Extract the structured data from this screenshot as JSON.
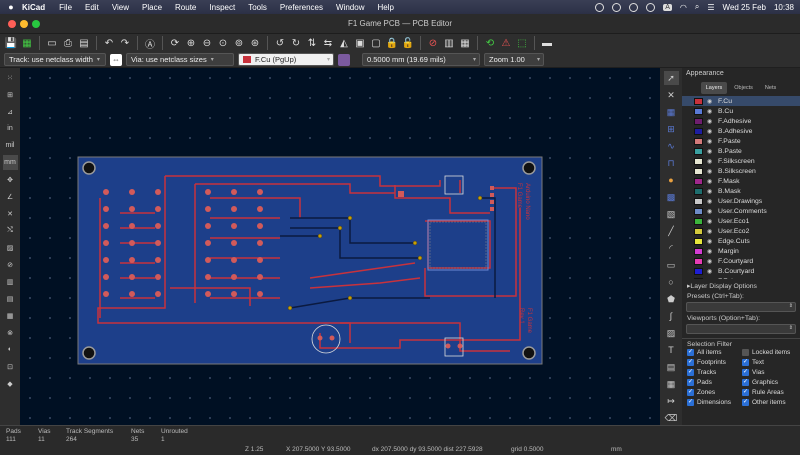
{
  "menubar": {
    "app": "KiCad",
    "items": [
      "File",
      "Edit",
      "View",
      "Place",
      "Route",
      "Inspect",
      "Tools",
      "Preferences",
      "Window",
      "Help"
    ],
    "badge": "A",
    "date": "Wed 25 Feb",
    "time": "10:38"
  },
  "window": {
    "title": "F1 Game PCB — PCB Editor"
  },
  "toolbar2": {
    "track": "Track: use netclass width",
    "via": "Via: use netclass sizes",
    "layer": "F.Cu (PgUp)",
    "grid": "0.5000 mm (19.69 mils)",
    "zoom": "Zoom 1.00"
  },
  "left_toolbar": {
    "units_in": "in",
    "units_mil": "mil",
    "units_mm": "mm"
  },
  "board": {
    "top_text": "Arduino Nano\nF1 Game",
    "bottom_text": "F1 Game\nRev 1"
  },
  "panel": {
    "title": "Appearance",
    "tabs": [
      "Layers",
      "Objects",
      "Nets"
    ],
    "layers": [
      {
        "name": "F.Cu",
        "color": "#c8323c"
      },
      {
        "name": "B.Cu",
        "color": "#5a7ad6"
      },
      {
        "name": "F.Adhesive",
        "color": "#6e1e6e"
      },
      {
        "name": "B.Adhesive",
        "color": "#1e1ea0"
      },
      {
        "name": "F.Paste",
        "color": "#d27a7a"
      },
      {
        "name": "B.Paste",
        "color": "#3aa0a0"
      },
      {
        "name": "F.Silkscreen",
        "color": "#e6e6d2"
      },
      {
        "name": "B.Silkscreen",
        "color": "#e6e6d2"
      },
      {
        "name": "F.Mask",
        "color": "#a0288c"
      },
      {
        "name": "B.Mask",
        "color": "#1e6e6e"
      },
      {
        "name": "User.Drawings",
        "color": "#c8c8c8"
      },
      {
        "name": "User.Comments",
        "color": "#6e8cc8"
      },
      {
        "name": "User.Eco1",
        "color": "#3cb43c"
      },
      {
        "name": "User.Eco2",
        "color": "#d2c83c"
      },
      {
        "name": "Edge.Cuts",
        "color": "#e6e63c"
      },
      {
        "name": "Margin",
        "color": "#d23cd2"
      },
      {
        "name": "F.Courtyard",
        "color": "#e63cb4"
      },
      {
        "name": "B.Courtyard",
        "color": "#1e1ed2"
      },
      {
        "name": "F.Fab",
        "color": "#b4b4b4"
      }
    ],
    "layer_display_options": "Layer Display Options",
    "presets_label": "Presets (Ctrl+Tab):",
    "viewports_label": "Viewports (Option+Tab):",
    "selection_filter": "Selection Filter",
    "filters": [
      {
        "label": "All items",
        "checked": true
      },
      {
        "label": "Locked items",
        "checked": false
      },
      {
        "label": "Footprints",
        "checked": true
      },
      {
        "label": "Text",
        "checked": true
      },
      {
        "label": "Tracks",
        "checked": true
      },
      {
        "label": "Vias",
        "checked": true
      },
      {
        "label": "Pads",
        "checked": true
      },
      {
        "label": "Graphics",
        "checked": true
      },
      {
        "label": "Zones",
        "checked": true
      },
      {
        "label": "Rule Areas",
        "checked": true
      },
      {
        "label": "Dimensions",
        "checked": true
      },
      {
        "label": "Other items",
        "checked": true
      }
    ]
  },
  "statusbar": {
    "pads_label": "Pads",
    "pads": "111",
    "vias_label": "Vias",
    "vias": "11",
    "tracks_label": "Track Segments",
    "tracks": "264",
    "nets_label": "Nets",
    "nets": "35",
    "unrouted_label": "Unrouted",
    "unrouted": "1",
    "z": "Z 1.25",
    "xy": "X 207.5000  Y 93.5000",
    "dxdy": "dx 207.5000  dy 93.5000  dist 227.5928",
    "grid": "grid 0.5000",
    "units": "mm"
  }
}
